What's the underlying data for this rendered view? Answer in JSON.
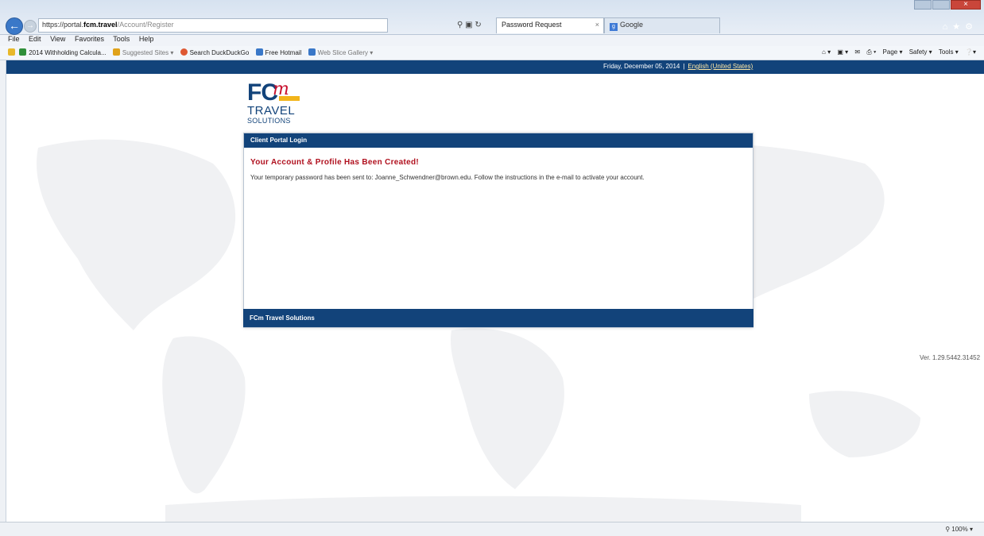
{
  "browser": {
    "address": {
      "scheme": "https://portal.",
      "host": "fcm.travel",
      "path": "/Account/Register"
    },
    "tabs": [
      {
        "label": "Password Request",
        "active": true
      },
      {
        "label": "Google",
        "active": false
      }
    ],
    "menu": [
      "File",
      "Edit",
      "View",
      "Favorites",
      "Tools",
      "Help"
    ],
    "favorites": [
      {
        "label": "2014 Withholding Calcula...",
        "icon": "calculator-icon",
        "color": "#2f8f3a"
      },
      {
        "label": "Suggested Sites ▾",
        "icon": "suggested-sites-icon",
        "color": "#e0a21a"
      },
      {
        "label": "Search DuckDuckGo",
        "icon": "duckduckgo-icon",
        "color": "#de5833"
      },
      {
        "label": "Free Hotmail",
        "icon": "ie-page-icon",
        "color": "#3a78c8"
      },
      {
        "label": "Web Slice Gallery ▾",
        "icon": "ie-page-icon",
        "color": "#3a78c8"
      }
    ],
    "command_bar": [
      "Page ▾",
      "Safety ▾",
      "Tools ▾"
    ],
    "zoom": "100%"
  },
  "page": {
    "topbar": {
      "date": "Friday, December 05, 2014",
      "separator": "|",
      "language": "English (United States)"
    },
    "logo": {
      "fc": "FC",
      "m": "m",
      "travel": "TRAVEL",
      "solutions": "SOLUTIONS"
    },
    "panel": {
      "header": "Client Portal Login",
      "title": "Your Account & Profile Has Been Created!",
      "message": "Your temporary password has been sent to: Joanne_Schwendner@brown.edu. Follow the instructions in the e-mail to activate your account.",
      "footer": "FCm Travel Solutions"
    },
    "version": "Ver. 1.29.5442.31452"
  },
  "colors": {
    "brand_navy": "#12437a",
    "title_red": "#b0101e",
    "logo_yellow": "#f2b41a"
  }
}
